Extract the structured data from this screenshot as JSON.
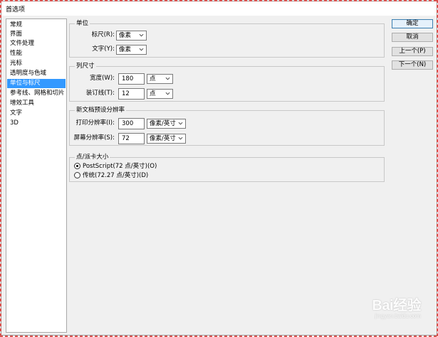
{
  "window": {
    "title": "首选项"
  },
  "sidebar": {
    "items": [
      {
        "label": "常规"
      },
      {
        "label": "界面"
      },
      {
        "label": "文件处理"
      },
      {
        "label": "性能"
      },
      {
        "label": "光标"
      },
      {
        "label": "透明度与色域"
      },
      {
        "label": "单位与标尺",
        "selected": true
      },
      {
        "label": "参考线、网格和切片"
      },
      {
        "label": "增效工具"
      },
      {
        "label": "文字"
      },
      {
        "label": "3D"
      }
    ]
  },
  "units": {
    "legend": "单位",
    "rulers_label": "标尺(R):",
    "rulers_value": "像素",
    "type_label": "文字(Y):",
    "type_value": "像素"
  },
  "column_size": {
    "legend": "列尺寸",
    "width_label": "宽度(W):",
    "width_value": "180",
    "width_unit": "点",
    "gutter_label": "装订线(T):",
    "gutter_value": "12",
    "gutter_unit": "点"
  },
  "new_doc_resolution": {
    "legend": "新文档预设分辨率",
    "print_label": "打印分辨率(I):",
    "print_value": "300",
    "print_unit": "像素/英寸",
    "screen_label": "屏幕分辨率(S):",
    "screen_value": "72",
    "screen_unit": "像素/英寸"
  },
  "point_pica": {
    "legend": "点/派卡大小",
    "options": [
      {
        "label": "PostScript(72 点/英寸)(O)",
        "checked": true
      },
      {
        "label": "传统(72.27 点/英寸)(D)",
        "checked": false
      }
    ]
  },
  "buttons": {
    "ok": "确定",
    "cancel": "取消",
    "prev": "上一个(P)",
    "next": "下一个(N)"
  },
  "watermark": {
    "text": "Bai",
    "suffix": "经验",
    "sub": "jingyan.baidu.com"
  },
  "colors": {
    "selection": "#3399ff",
    "dialog_bg": "#f0f0f0",
    "frame_dash": "#d9534f"
  }
}
